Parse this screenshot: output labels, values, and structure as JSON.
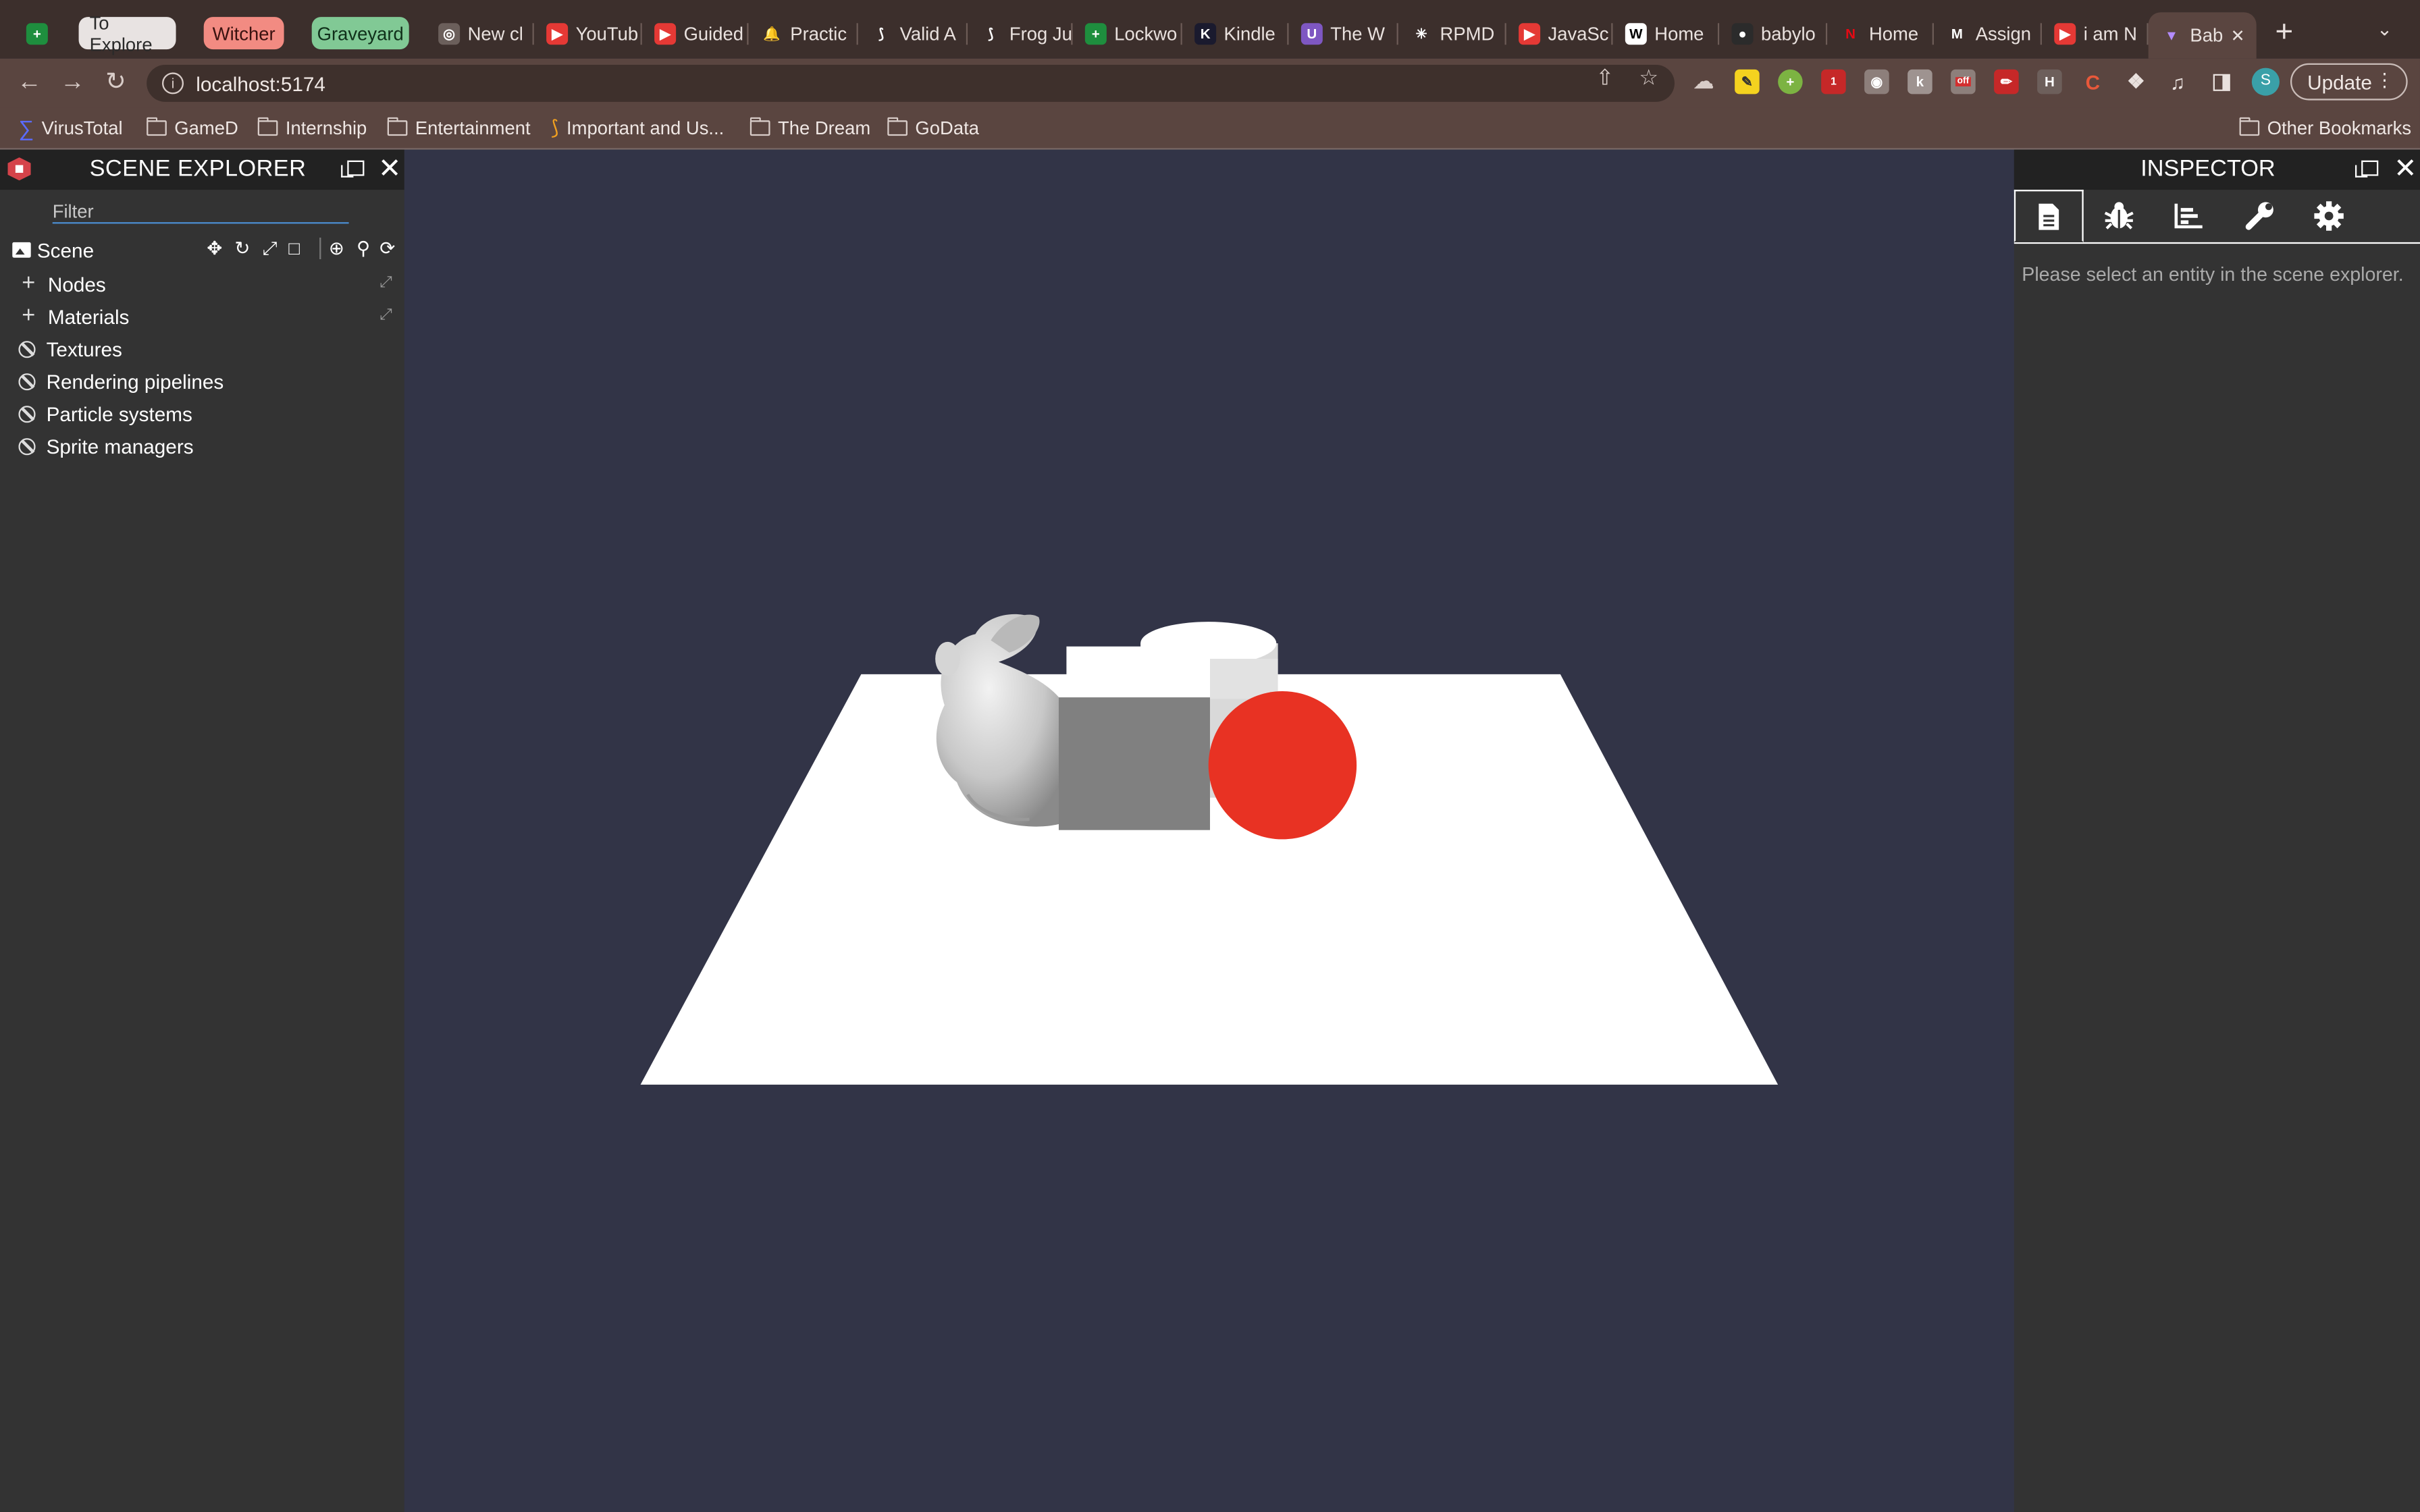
{
  "browser": {
    "tab_groups": [
      {
        "label": "To Explore",
        "color": "#e8e3e2",
        "text_color": "#2a2a2a"
      },
      {
        "label": "Witcher",
        "color": "#f28b82",
        "text_color": "#3a1210"
      },
      {
        "label": "Graveyard",
        "color": "#81c995",
        "text_color": "#10301a"
      }
    ],
    "tabs": [
      {
        "label": "New cl",
        "icon": "chatgpt-icon"
      },
      {
        "label": "YouTub",
        "icon": "youtube-music-icon"
      },
      {
        "label": "Guided",
        "icon": "youtube-icon"
      },
      {
        "label": "Practic",
        "icon": "bell-icon"
      },
      {
        "label": "Valid A",
        "icon": "leetcode-icon"
      },
      {
        "label": "Frog Ju",
        "icon": "leetcode-icon"
      },
      {
        "label": "Lockwo",
        "icon": "google-sheets-icon"
      },
      {
        "label": "Kindle",
        "icon": "kindle-icon"
      },
      {
        "label": "The W",
        "icon": "shield-icon"
      },
      {
        "label": "RPMD",
        "icon": "asterisk-icon"
      },
      {
        "label": "JavaSc",
        "icon": "youtube-icon"
      },
      {
        "label": "Home",
        "icon": "wix-icon"
      },
      {
        "label": "babylo",
        "icon": "github-icon"
      },
      {
        "label": "Home",
        "icon": "netflix-icon"
      },
      {
        "label": "Assign",
        "icon": "gmail-icon"
      },
      {
        "label": "i am N",
        "icon": "youtube-icon"
      },
      {
        "label": "Bab",
        "icon": "vite-icon",
        "active": true
      }
    ],
    "url": "localhost:5174",
    "update_label": "Update",
    "avatar_letter": "S",
    "bookmarks": [
      {
        "label": "VirusTotal",
        "icon": "virustotal-icon"
      },
      {
        "label": "GameD",
        "icon": "folder-icon"
      },
      {
        "label": "Internship",
        "icon": "folder-icon"
      },
      {
        "label": "Entertainment",
        "icon": "folder-icon"
      },
      {
        "label": "Important and Us...",
        "icon": "leetcode-icon"
      },
      {
        "label": "The Dream",
        "icon": "folder-icon"
      },
      {
        "label": "GoData",
        "icon": "folder-icon"
      }
    ],
    "other_bookmarks": "Other Bookmarks",
    "extensions": {
      "badge_1": "1",
      "badge_off": "off",
      "ext_h": "H"
    }
  },
  "scene_explorer": {
    "title": "SCENE EXPLORER",
    "filter_placeholder": "Filter",
    "scene_label": "Scene",
    "items": [
      {
        "label": "Nodes",
        "expandable": true
      },
      {
        "label": "Materials",
        "expandable": true
      },
      {
        "label": "Textures",
        "expandable": false
      },
      {
        "label": "Rendering pipelines",
        "expandable": false
      },
      {
        "label": "Particle systems",
        "expandable": false
      },
      {
        "label": "Sprite managers",
        "expandable": false
      }
    ]
  },
  "viewport": {
    "background": "#323447",
    "ground_color": "#ffffff",
    "box_color": "#808080",
    "sphere_color": "#e83223",
    "cylinder_color": "#ffffff"
  },
  "inspector": {
    "title": "INSPECTOR",
    "tabs": [
      "document-icon",
      "bug-icon",
      "chart-icon",
      "wrench-icon",
      "gear-icon"
    ],
    "empty_message": "Please select an entity in the scene explorer."
  }
}
